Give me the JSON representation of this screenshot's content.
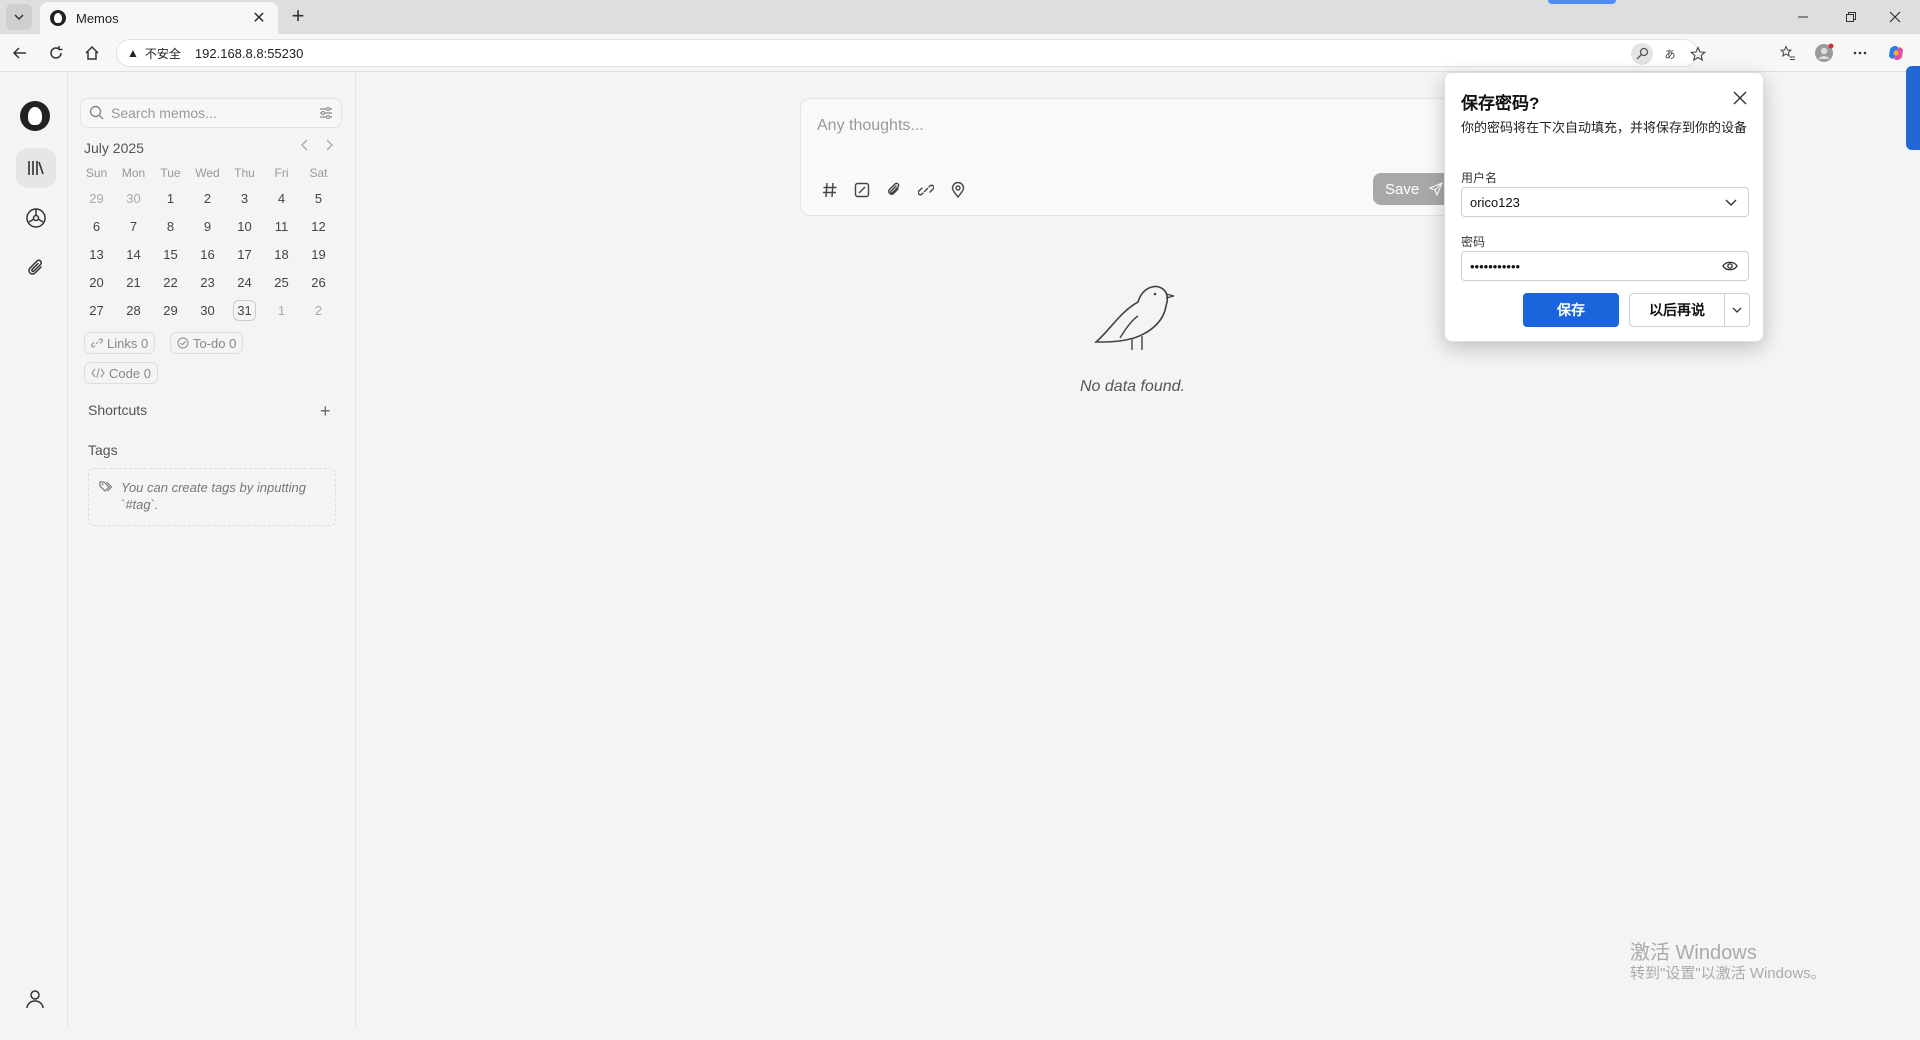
{
  "browser": {
    "tab_title": "Memos",
    "tab_close": "✕",
    "new_tab": "+",
    "security_label": "不安全",
    "security_icon": "warning-triangle-icon",
    "url": "192.168.8.8:55230"
  },
  "sidebar": {
    "search_placeholder": "Search memos...",
    "calendar": {
      "month_label": "July 2025",
      "weekdays": [
        "Sun",
        "Mon",
        "Tue",
        "Wed",
        "Thu",
        "Fri",
        "Sat"
      ],
      "days": [
        {
          "d": "29",
          "muted": true
        },
        {
          "d": "30",
          "muted": true
        },
        {
          "d": "1"
        },
        {
          "d": "2"
        },
        {
          "d": "3"
        },
        {
          "d": "4"
        },
        {
          "d": "5"
        },
        {
          "d": "6"
        },
        {
          "d": "7"
        },
        {
          "d": "8"
        },
        {
          "d": "9"
        },
        {
          "d": "10"
        },
        {
          "d": "11"
        },
        {
          "d": "12"
        },
        {
          "d": "13"
        },
        {
          "d": "14"
        },
        {
          "d": "15"
        },
        {
          "d": "16"
        },
        {
          "d": "17"
        },
        {
          "d": "18"
        },
        {
          "d": "19"
        },
        {
          "d": "20"
        },
        {
          "d": "21"
        },
        {
          "d": "22"
        },
        {
          "d": "23"
        },
        {
          "d": "24"
        },
        {
          "d": "25"
        },
        {
          "d": "26"
        },
        {
          "d": "27"
        },
        {
          "d": "28"
        },
        {
          "d": "29"
        },
        {
          "d": "30"
        },
        {
          "d": "31",
          "today": true
        },
        {
          "d": "1",
          "muted": true
        },
        {
          "d": "2",
          "muted": true
        }
      ]
    },
    "stats": {
      "links": "Links 0",
      "todo": "To-do 0",
      "code": "Code 0"
    },
    "shortcuts_title": "Shortcuts",
    "shortcuts_add": "+",
    "tags_title": "Tags",
    "tags_hint": "You can create tags by inputting `#tag`."
  },
  "editor": {
    "placeholder": "Any thoughts...",
    "save_label": "Save"
  },
  "empty_state": {
    "text": "No data found."
  },
  "password_popup": {
    "title": "保存密码?",
    "description": "你的密码将在下次自动填充，并将保存到你的设备",
    "username_label": "用户名",
    "username_value": "orico123",
    "password_label": "密码",
    "password_value": "•••••••••••",
    "save_button": "保存",
    "later_button": "以后再说"
  },
  "watermark": {
    "line1": "激活 Windows",
    "line2": "转到\"设置\"以激活 Windows。"
  },
  "colors": {
    "primary_blue": "#1a64dc",
    "save_gray": "#a8a8a8"
  }
}
